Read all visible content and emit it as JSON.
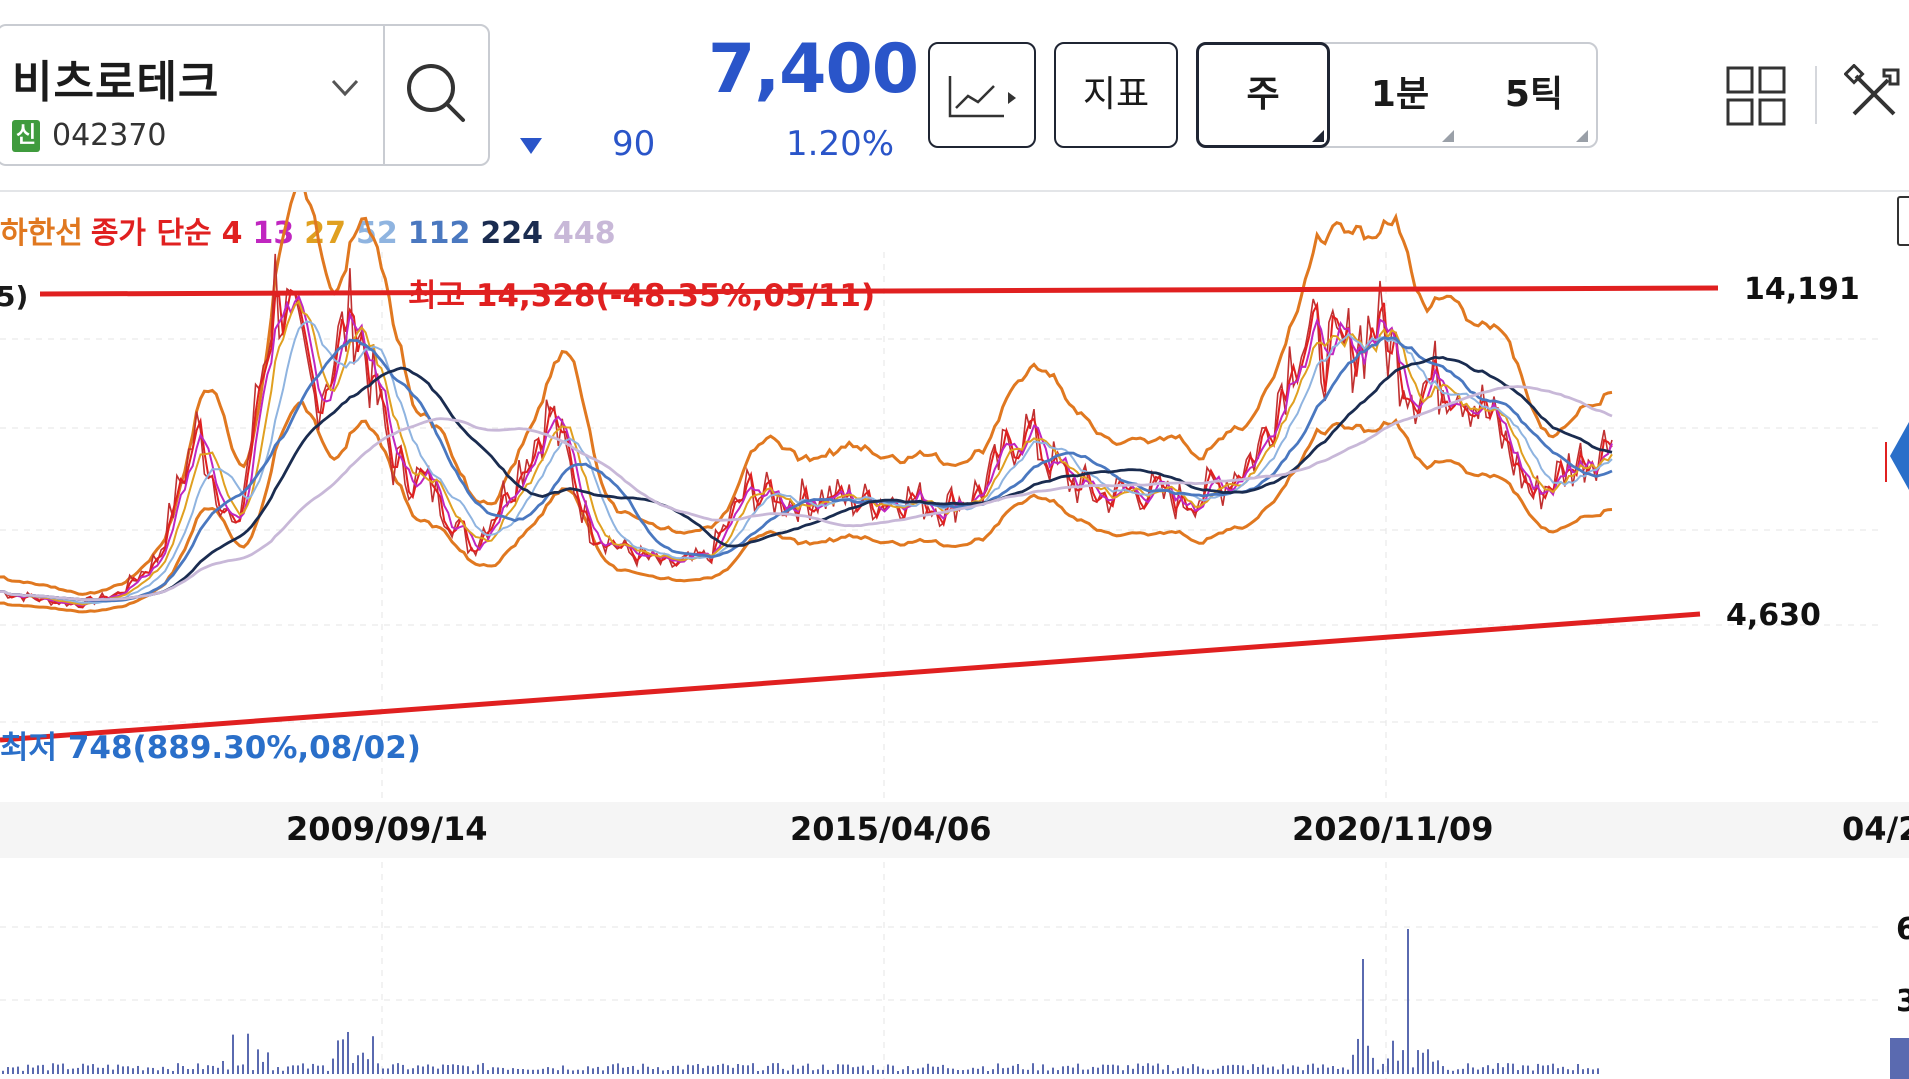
{
  "stock": {
    "name": "비츠로테크",
    "badge": "신",
    "code": "042370"
  },
  "quote": {
    "price": "7,400",
    "change": "90",
    "change_pct": "1.20%",
    "direction": "down"
  },
  "toolbar": {
    "indicator_label": "지표",
    "period_week": "주",
    "period_1m": "1분",
    "period_5tick": "5틱"
  },
  "legend": {
    "prefix": "하한선",
    "desc": "종가 단순",
    "periods": [
      "4",
      "13",
      "27",
      "52",
      "112",
      "224",
      "448"
    ],
    "period_colors": [
      "#e02020",
      "#c026c0",
      "#e0a020",
      "#8fb4e0",
      "#4a78c0",
      "#1a2c50",
      "#c8b8d8"
    ]
  },
  "annotations": {
    "high": "최고 14,328(-48.35%,05/11)",
    "low": "최저 748(889.30%,08/02)",
    "left_fragment": "5)"
  },
  "right_labels": {
    "upper": "14,191",
    "lower": "4,630"
  },
  "x_axis": {
    "dates": [
      "2009/09/14",
      "2015/04/06",
      "2020/11/09",
      "04/2"
    ]
  },
  "volume_ticks": [
    "6",
    "3"
  ],
  "colors": {
    "price_blue": "#2a55c9",
    "trend_red": "#e02020",
    "band_orange": "#e07820",
    "badge_green": "#3f9b3d"
  },
  "chart_data": {
    "type": "line",
    "y_scale": "price (KRW)",
    "upper_trendline_value": 14191,
    "lower_trendline_value": 4630,
    "high": {
      "value": 14328,
      "date": "05/11"
    },
    "low": {
      "value": 748,
      "date": "08/02"
    },
    "x_ticks": [
      "2009/09/14",
      "2015/04/06",
      "2020/11/09",
      "04/2"
    ],
    "close_approx": [
      1500,
      1200,
      1000,
      1400,
      2800,
      7800,
      3600,
      13500,
      9000,
      12500,
      6500,
      5500,
      3200,
      5800,
      8500,
      4000,
      3000,
      2500,
      2800,
      5500,
      5000,
      5200,
      5000,
      5200,
      4800,
      5500,
      8000,
      6000,
      5200,
      5500,
      5000,
      5600,
      7000,
      11500,
      10500,
      12000,
      9500,
      10000,
      8000,
      5200,
      6500,
      7400
    ]
  }
}
